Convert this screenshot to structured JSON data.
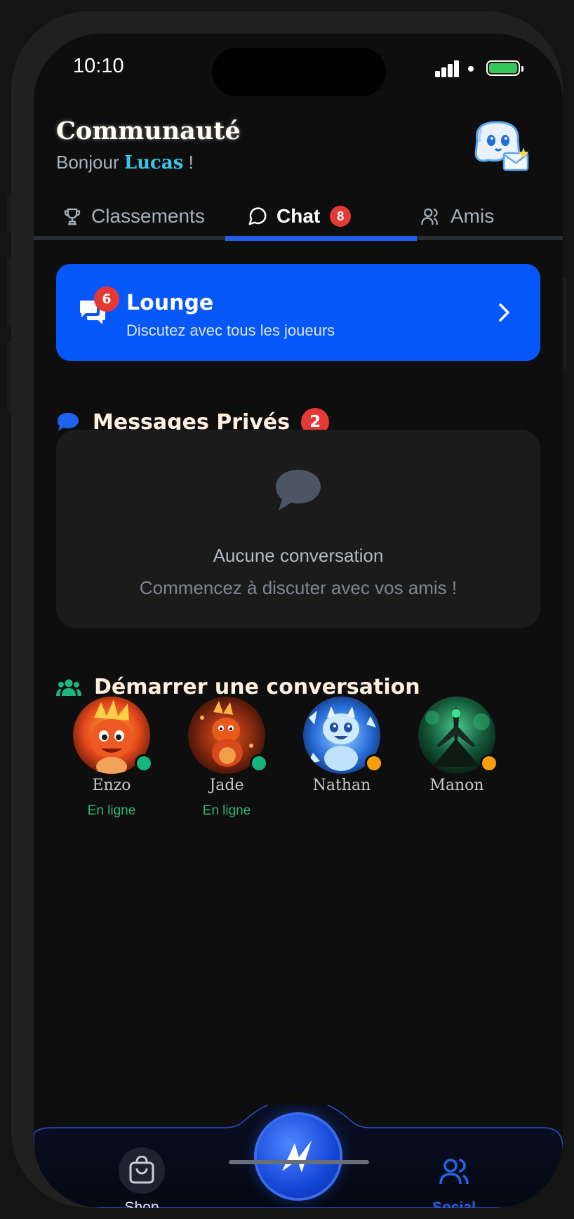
{
  "status_bar": {
    "time": "10:10"
  },
  "header": {
    "title": "Communauté",
    "greeting_prefix": "Bonjour",
    "username": "Lucas",
    "greeting_suffix": "!"
  },
  "tabs": [
    {
      "label": "Classements",
      "icon": "trophy-icon"
    },
    {
      "label": "Chat",
      "icon": "chat-bubble-icon",
      "badge": "8",
      "active": true
    },
    {
      "label": "Amis",
      "icon": "users-icon"
    }
  ],
  "lounge": {
    "title": "Lounge",
    "subtitle": "Discutez avec tous les joueurs",
    "badge": "6",
    "color": "#0657f9"
  },
  "private_messages": {
    "title": "Messages Privés",
    "badge": "2",
    "empty_title": "Aucune conversation",
    "empty_subtitle": "Commencez à discuter avec vos amis !"
  },
  "start_conversation": {
    "title": "Démarrer une conversation",
    "friends": [
      {
        "name": "Enzo",
        "status_text": "En ligne",
        "status": "online"
      },
      {
        "name": "Jade",
        "status_text": "En ligne",
        "status": "online"
      },
      {
        "name": "Nathan",
        "status_text": "",
        "status": "away"
      },
      {
        "name": "Manon",
        "status_text": "",
        "status": "away"
      }
    ]
  },
  "bottom_nav": {
    "items": [
      {
        "label": "Shop",
        "icon": "shopping-bag-icon",
        "active": false
      },
      {
        "label": "Social",
        "icon": "users-icon",
        "active": true
      }
    ],
    "center_icon": "app-logo-icon"
  },
  "colors": {
    "accent_blue": "#0657f9",
    "badge_red": "#e53935",
    "online_green": "#16b57c",
    "away_orange": "#f5a00c"
  }
}
